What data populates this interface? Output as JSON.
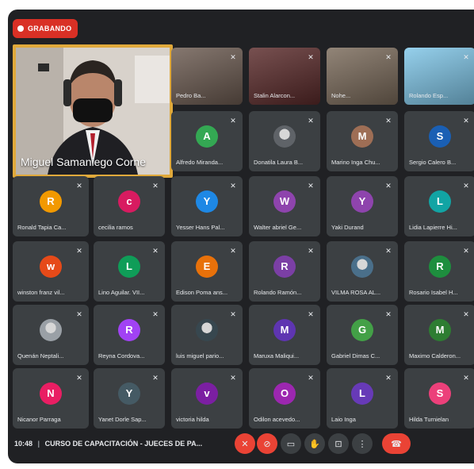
{
  "recording": {
    "label": "GRABANDO"
  },
  "featured": {
    "name": "Miguel Samaniego Corne"
  },
  "video_tiles": [
    {
      "name": "Pedro Ba...",
      "tone": "#6b5a50"
    },
    {
      "name": "Stalin Alarcon...",
      "tone": "#5a2a2a"
    },
    {
      "name": "Nohe...",
      "tone": "#7a6a5a"
    },
    {
      "name": "Rolando Esp...",
      "tone": "#7fc6e8"
    }
  ],
  "participants": [
    {
      "name": "Alfredo Miranda...",
      "initial": "A",
      "color": "#34a853"
    },
    {
      "name": "Donatila Laura B...",
      "initial": "",
      "color": "#5f6368",
      "photo": true
    },
    {
      "name": "Marino Inga Chu...",
      "initial": "M",
      "color": "#9e6e55"
    },
    {
      "name": "Sergio Calero B...",
      "initial": "S",
      "color": "#1a5fb4"
    },
    {
      "name": "Ronald Tapia Ca...",
      "initial": "R",
      "color": "#f29900"
    },
    {
      "name": "cecilia ramos",
      "initial": "c",
      "color": "#d81b60"
    },
    {
      "name": "Yesser Hans Pal...",
      "initial": "Y",
      "color": "#1e88e5"
    },
    {
      "name": "Walter abriel Ge...",
      "initial": "W",
      "color": "#8e44ad"
    },
    {
      "name": "Yaki Durand",
      "initial": "Y",
      "color": "#8e44ad"
    },
    {
      "name": "Lidia Lapierre Hi...",
      "initial": "L",
      "color": "#12a4a4"
    },
    {
      "name": "winston franz vil...",
      "initial": "w",
      "color": "#e64a19"
    },
    {
      "name": "Lino Aguilar. VII...",
      "initial": "L",
      "color": "#0f9d58"
    },
    {
      "name": "Edison Poma ans...",
      "initial": "E",
      "color": "#e8710a"
    },
    {
      "name": "Rolando Ramón...",
      "initial": "R",
      "color": "#7b3fa5"
    },
    {
      "name": "VILMA ROSA AL...",
      "initial": "",
      "color": "#4a6f8a",
      "photo": true
    },
    {
      "name": "Rosario Isabel H...",
      "initial": "R",
      "color": "#1e8e3e"
    },
    {
      "name": "Quenán Neptali...",
      "initial": "",
      "color": "#9aa0a6",
      "photo": true
    },
    {
      "name": "Reyna Cordova...",
      "initial": "R",
      "color": "#a142f4"
    },
    {
      "name": "luis miguel pario...",
      "initial": "",
      "color": "#37474f",
      "photo": true
    },
    {
      "name": "Maruxa Maliqui...",
      "initial": "M",
      "color": "#5e35b1"
    },
    {
      "name": "Gabriel Dimas C...",
      "initial": "G",
      "color": "#43a047"
    },
    {
      "name": "Maximo Calderon...",
      "initial": "M",
      "color": "#2e7d32"
    },
    {
      "name": "Nicanor Parraga",
      "initial": "N",
      "color": "#e91e63"
    },
    {
      "name": "Yanet Dorle Sap...",
      "initial": "Y",
      "color": "#455a64"
    },
    {
      "name": "victoria hilda",
      "initial": "v",
      "color": "#7b1fa2"
    },
    {
      "name": "Odilon acevedo...",
      "initial": "O",
      "color": "#9c27b0"
    },
    {
      "name": "Laio Inga",
      "initial": "L",
      "color": "#673ab7"
    },
    {
      "name": "Hilda Turnielan",
      "initial": "S",
      "color": "#ec407a"
    }
  ],
  "bottom_bar": {
    "time": "10:48",
    "separator": "|",
    "meeting_title": "CURSO DE CAPACITACIÓN - JUECES DE PA...",
    "controls": [
      {
        "icon": "mic-off-icon",
        "glyph": "✕"
      },
      {
        "icon": "camera-off-icon",
        "glyph": "⊘"
      },
      {
        "icon": "captions-icon",
        "glyph": "▭"
      },
      {
        "icon": "raise-hand-icon",
        "glyph": "✋"
      },
      {
        "icon": "present-icon",
        "glyph": "⊡"
      },
      {
        "icon": "more-options-icon",
        "glyph": "⋮"
      },
      {
        "icon": "end-call-icon",
        "glyph": "☎"
      }
    ]
  }
}
